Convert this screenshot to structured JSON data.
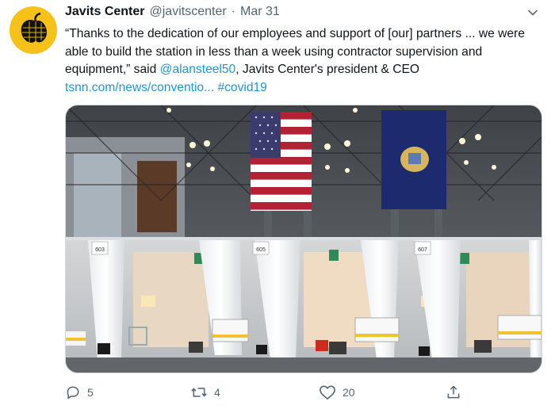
{
  "tweet": {
    "author_name": "Javits Center",
    "handle": "@javitscenter",
    "separator": "·",
    "date": "Mar 31",
    "text_part1": "“Thanks to the dedication of our employees and support of [our] partners ... we were able to build the station in less than a week using contractor supervision and equipment,” said ",
    "mention": "@alansteel50",
    "text_part2": ", Javits Center's president & CEO ",
    "link": "tsnn.com/news/conventio...",
    "hashtag": "#covid19",
    "media": {
      "bed_labels": [
        "603",
        "605",
        "607"
      ]
    },
    "actions": {
      "replies": "5",
      "retweets": "4",
      "likes": "20"
    },
    "colors": {
      "link": "#1b95e0",
      "avatar": "#f6c21a"
    }
  }
}
